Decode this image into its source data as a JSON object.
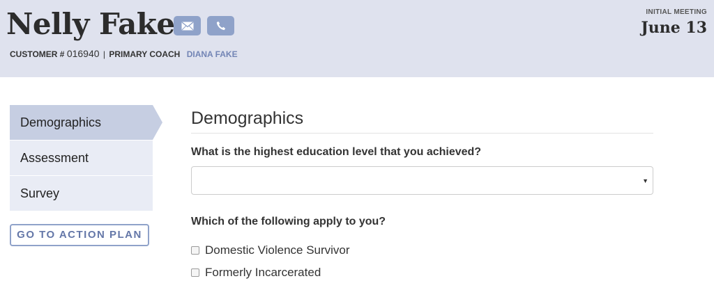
{
  "header": {
    "customer_name": "Nelly Fake",
    "customer_label": "CUSTOMER #",
    "customer_number": "016940",
    "separator": "|",
    "coach_label": "PRIMARY COACH",
    "coach_name": "DIANA FAKE",
    "meeting_label": "INITIAL MEETING",
    "meeting_date": "June 13",
    "icons": [
      "envelope-icon",
      "phone-icon"
    ]
  },
  "sidebar": {
    "items": [
      {
        "label": "Demographics",
        "active": true
      },
      {
        "label": "Assessment",
        "active": false
      },
      {
        "label": "Survey",
        "active": false
      }
    ],
    "action_button": "GO TO ACTION PLAN"
  },
  "main": {
    "title": "Demographics",
    "questions": [
      {
        "label": "What is the highest education level that you achieved?",
        "value": "",
        "caret": "▼"
      },
      {
        "label": "Which of the following apply to you?"
      }
    ],
    "options": [
      {
        "label": "Domestic Violence Survivor",
        "checked": false
      },
      {
        "label": "Formerly Incarcerated",
        "checked": false
      }
    ]
  },
  "colors": {
    "header_bg": "#dfe2ee",
    "accent": "#8fa2c9",
    "link": "#7385b5",
    "nav_active": "#c6cee2",
    "nav_bg": "#e9ecf5"
  }
}
